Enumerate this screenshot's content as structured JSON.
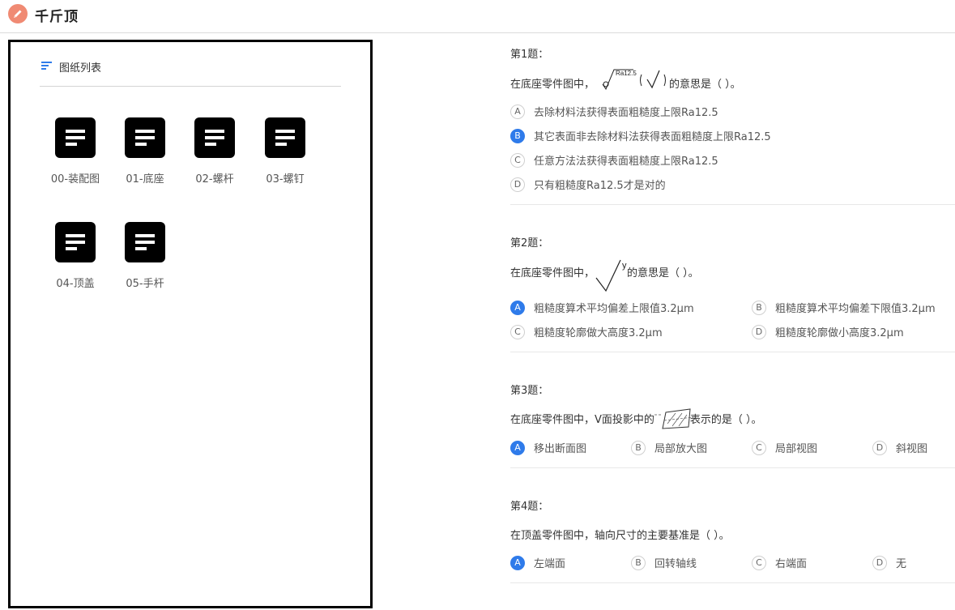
{
  "app": {
    "title": "千斤顶",
    "logo_icon": "pencil-icon",
    "logo_color": "#f08a73"
  },
  "drawings": {
    "title": "图纸列表",
    "items": [
      "00-装配图",
      "01-底座",
      "02-螺杆",
      "03-螺钉",
      "04-顶盖",
      "05-手杆"
    ]
  },
  "accent": "#2f7bea",
  "questions": [
    {
      "num": "第1题：",
      "pre": "在底座零件图中，",
      "symbol_label": "Ra12.5",
      "post": "的意思是（ ）。",
      "options": [
        {
          "letter": "A",
          "text": "去除材料法获得表面粗糙度上限Ra12.5"
        },
        {
          "letter": "B",
          "text": "其它表面非去除材料法获得表面粗糙度上限Ra12.5",
          "selected": true
        },
        {
          "letter": "C",
          "text": "任意方法法获得表面粗糙度上限Ra12.5"
        },
        {
          "letter": "D",
          "text": "只有粗糙度Ra12.5才是对的"
        }
      ]
    },
    {
      "num": "第2题：",
      "pre": "在底座零件图中，",
      "symbol_label": "y",
      "post": "的意思是（ ）。",
      "options": [
        {
          "letter": "A",
          "text": "粗糙度算术平均偏差上限值3.2μm",
          "selected": true
        },
        {
          "letter": "B",
          "text": "粗糙度算术平均偏差下限值3.2μm"
        },
        {
          "letter": "C",
          "text": "粗糙度轮廓做大高度3.2μm"
        },
        {
          "letter": "D",
          "text": "粗糙度轮廓做小高度3.2μm"
        }
      ]
    },
    {
      "num": "第3题：",
      "pre": "在底座零件图中，V面投影中的",
      "post": "表示的是（ ）。",
      "options": [
        {
          "letter": "A",
          "text": "移出断面图",
          "selected": true
        },
        {
          "letter": "B",
          "text": "局部放大图"
        },
        {
          "letter": "C",
          "text": "局部视图"
        },
        {
          "letter": "D",
          "text": "斜视图"
        }
      ]
    },
    {
      "num": "第4题：",
      "text": "在顶盖零件图中，轴向尺寸的主要基准是（ ）。",
      "options": [
        {
          "letter": "A",
          "text": "左端面",
          "selected": true
        },
        {
          "letter": "B",
          "text": "回转轴线"
        },
        {
          "letter": "C",
          "text": "右端面"
        },
        {
          "letter": "D",
          "text": "无"
        }
      ]
    }
  ]
}
